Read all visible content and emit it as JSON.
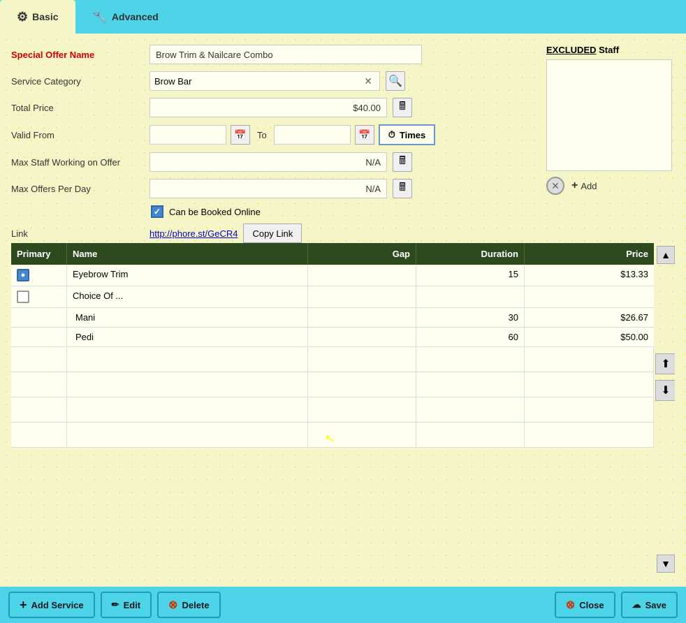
{
  "tabs": [
    {
      "id": "basic",
      "label": "Basic",
      "icon": "⚙",
      "active": true
    },
    {
      "id": "advanced",
      "label": "Advanced",
      "icon": "🔧",
      "active": false
    }
  ],
  "form": {
    "special_offer_name_label": "Special Offer Name",
    "special_offer_name_value": "Brow Trim & Nailcare Combo",
    "service_category_label": "Service Category",
    "service_category_value": "Brow Bar",
    "total_price_label": "Total Price",
    "total_price_value": "$40.00",
    "valid_from_label": "Valid From",
    "valid_to_label": "To",
    "times_label": "Times",
    "max_staff_label": "Max Staff Working on Offer",
    "max_staff_value": "N/A",
    "max_offers_label": "Max Offers Per Day",
    "max_offers_value": "N/A",
    "can_book_online_label": "Can be Booked Online",
    "link_label": "Link",
    "link_url": "http://phore.st/GeCR4",
    "copy_link_label": "Copy Link"
  },
  "excluded_staff": {
    "title_bold": "EXCLUDED",
    "title_rest": " Staff",
    "add_label": "Add"
  },
  "table": {
    "columns": {
      "primary": "Primary",
      "name": "Name",
      "gap": "Gap",
      "duration": "Duration",
      "price": "Price"
    },
    "rows": [
      {
        "primary_selected": true,
        "name": "Eyebrow Trim",
        "gap": "",
        "duration": "15",
        "price": "$13.33",
        "is_choice": false
      },
      {
        "primary_selected": false,
        "name": "Choice Of ...",
        "gap": "",
        "duration": "",
        "price": "",
        "is_choice": true,
        "children": [
          {
            "name": "Mani",
            "gap": "",
            "duration": "30",
            "price": "$26.67"
          },
          {
            "name": "Pedi",
            "gap": "",
            "duration": "60",
            "price": "$50.00"
          }
        ]
      }
    ]
  },
  "bottom_bar": {
    "add_service_label": "Add Service",
    "edit_label": "Edit",
    "delete_label": "Delete",
    "close_label": "Close",
    "save_label": "Save"
  }
}
